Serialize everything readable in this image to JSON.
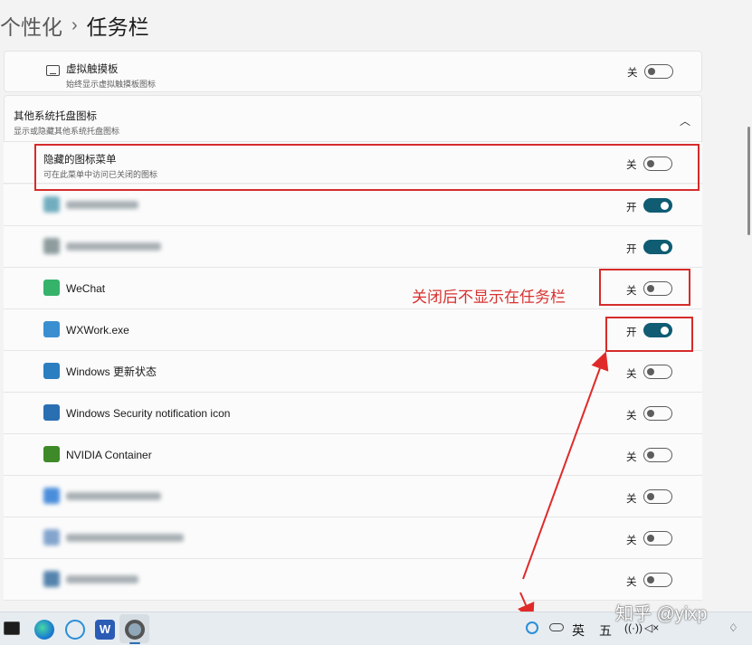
{
  "breadcrumb": {
    "parent": "个性化",
    "separator": "›",
    "current": "任务栏"
  },
  "touchpad_row": {
    "title": "虚拟触摸板",
    "subtitle": "始终显示虚拟触摸板图标",
    "state": "关",
    "on": false
  },
  "tray_section": {
    "title": "其他系统托盘图标",
    "subtitle": "显示或隐藏其他系统托盘图标",
    "chevron": "chevron-up-icon"
  },
  "hidden_menu_row": {
    "title": "隐藏的图标菜单",
    "subtitle": "可在此菜单中访问已关闭的图标",
    "state": "关",
    "on": false
  },
  "tray_items": [
    {
      "name": "",
      "state": "开",
      "on": true,
      "blurred": true,
      "icon": "app-icon",
      "color": "#5aa0b5"
    },
    {
      "name": "",
      "state": "开",
      "on": true,
      "blurred": true,
      "icon": "app-icon",
      "color": "#7b8c8e"
    },
    {
      "name": "WeChat",
      "state": "关",
      "on": false,
      "blurred": false,
      "icon": "wechat-icon",
      "color": "#35b36b"
    },
    {
      "name": "WXWork.exe",
      "state": "开",
      "on": true,
      "blurred": false,
      "icon": "wxwork-icon",
      "color": "#3a8fd1"
    },
    {
      "name": "Windows 更新状态",
      "state": "关",
      "on": false,
      "blurred": false,
      "icon": "windows-update-icon",
      "color": "#2b7fc0"
    },
    {
      "name": "Windows Security notification icon",
      "state": "关",
      "on": false,
      "blurred": false,
      "icon": "shield-icon",
      "color": "#2a6fb2"
    },
    {
      "name": "NVIDIA Container",
      "state": "关",
      "on": false,
      "blurred": false,
      "icon": "nvidia-icon",
      "color": "#3f8a28"
    },
    {
      "name": "",
      "state": "关",
      "on": false,
      "blurred": true,
      "icon": "app-icon",
      "color": "#2c7bd6"
    },
    {
      "name": "",
      "state": "关",
      "on": false,
      "blurred": true,
      "icon": "app-icon",
      "color": "#6f96c6"
    },
    {
      "name": "",
      "state": "关",
      "on": false,
      "blurred": true,
      "icon": "app-icon",
      "color": "#3a6fa0"
    }
  ],
  "annotation": {
    "text": "关闭后不显示在任务栏"
  },
  "taskbar": {
    "ime_lang": "英",
    "ime_mode": "五",
    "watermark": "知乎 @yixp"
  },
  "colors": {
    "toggle_on": "#0f5c73",
    "annotation_red": "#d62b2b"
  }
}
